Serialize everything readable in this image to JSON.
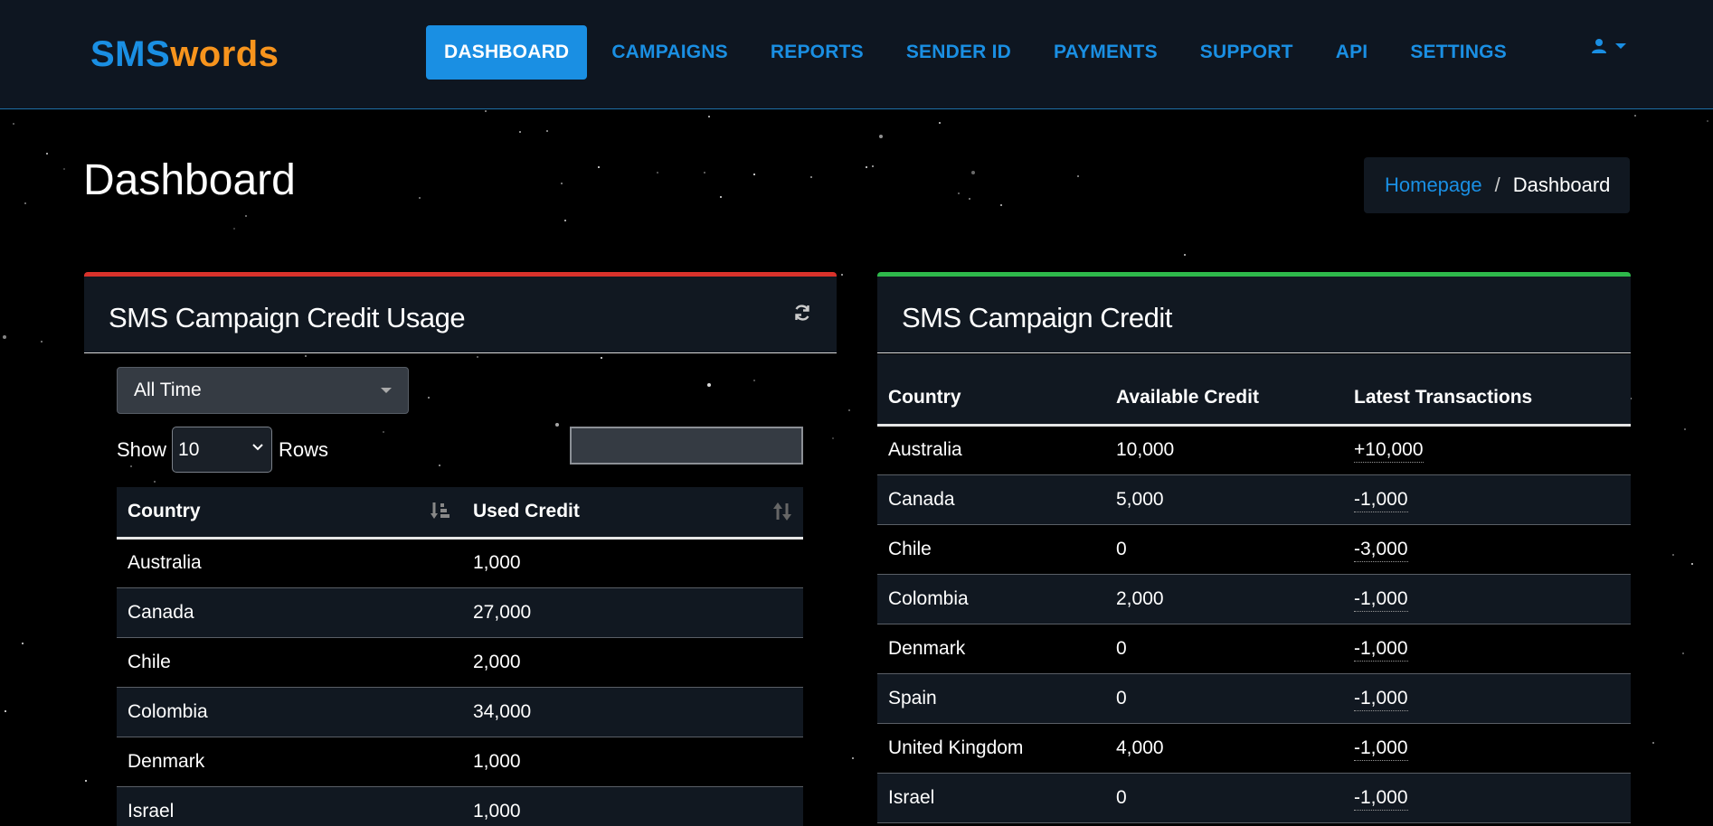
{
  "brand": {
    "part1": "SMS",
    "part2": "words"
  },
  "nav": {
    "items": [
      {
        "label": "DASHBOARD",
        "active": true
      },
      {
        "label": "CAMPAIGNS"
      },
      {
        "label": "REPORTS"
      },
      {
        "label": "SENDER ID"
      },
      {
        "label": "PAYMENTS"
      },
      {
        "label": "SUPPORT"
      },
      {
        "label": "API"
      },
      {
        "label": "SETTINGS"
      }
    ],
    "user_icon": "user-icon"
  },
  "page": {
    "title": "Dashboard"
  },
  "breadcrumb": {
    "home": "Homepage",
    "separator": "/",
    "current": "Dashboard"
  },
  "usage_panel": {
    "title": "SMS Campaign Credit Usage",
    "refresh_icon": "refresh-icon",
    "period": "All Time",
    "show_label": "Show",
    "rows_value": "10",
    "rows_label": "Rows",
    "search_value": "",
    "columns": [
      "Country",
      "Used Credit"
    ],
    "rows": [
      [
        "Australia",
        "1,000"
      ],
      [
        "Canada",
        "27,000"
      ],
      [
        "Chile",
        "2,000"
      ],
      [
        "Colombia",
        "34,000"
      ],
      [
        "Denmark",
        "1,000"
      ],
      [
        "Israel",
        "1,000"
      ]
    ]
  },
  "credit_panel": {
    "title": "SMS Campaign Credit",
    "columns": [
      "Country",
      "Available Credit",
      "Latest Transactions"
    ],
    "rows": [
      [
        "Australia",
        "10,000",
        "+10,000"
      ],
      [
        "Canada",
        "5,000",
        "-1,000"
      ],
      [
        "Chile",
        "0",
        "-3,000"
      ],
      [
        "Colombia",
        "2,000",
        "-1,000"
      ],
      [
        "Denmark",
        "0",
        "-1,000"
      ],
      [
        "Spain",
        "0",
        "-1,000"
      ],
      [
        "United Kingdom",
        "4,000",
        "-1,000"
      ],
      [
        "Israel",
        "0",
        "-1,000"
      ]
    ]
  },
  "colors": {
    "accent": "#1a8fe3",
    "brand_orange": "#f7941d",
    "usage_border": "#d9322b",
    "credit_border": "#2eb84b",
    "navbar_bg": "#0e1621"
  }
}
